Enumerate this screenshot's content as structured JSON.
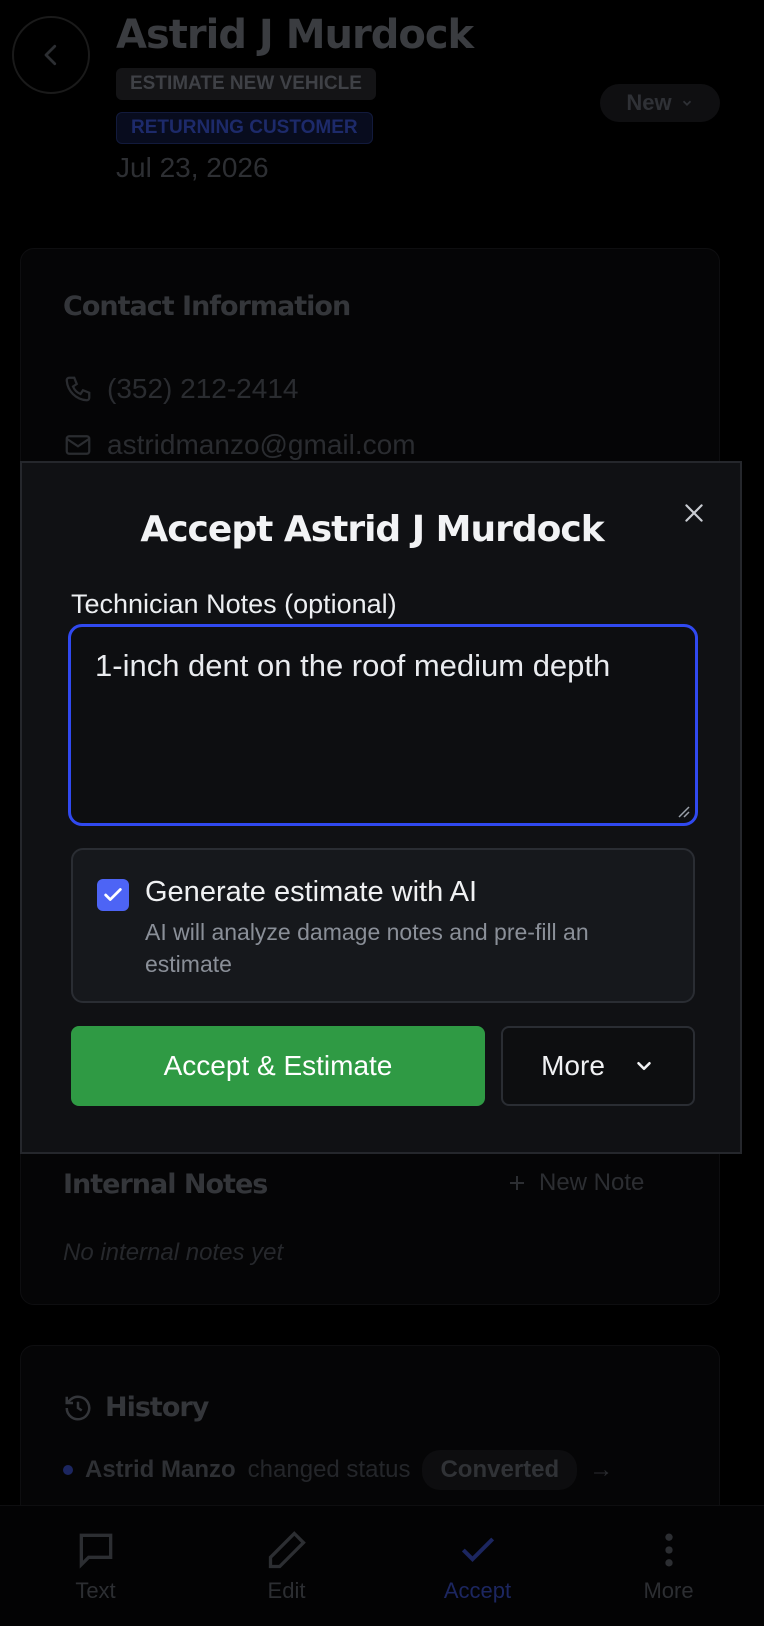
{
  "header": {
    "customer_name": "Astrid J Murdock",
    "type_tag": "ESTIMATE NEW VEHICLE",
    "customer_tag": "RETURNING CUSTOMER",
    "date": "Jul 23, 2026",
    "status": "New"
  },
  "contact": {
    "title": "Contact Information",
    "phone": "(352) 212-2414",
    "email": "astridmanzo@gmail.com"
  },
  "internal_notes": {
    "title": "Internal Notes",
    "new_note_label": "New Note",
    "empty_text": "No internal notes yet"
  },
  "history": {
    "title": "History",
    "entry_user": "Astrid Manzo",
    "entry_action": "changed status",
    "entry_status": "Converted",
    "entry_arrow": "→"
  },
  "bottom_nav": {
    "items": [
      {
        "label": "Text",
        "icon": "message-icon"
      },
      {
        "label": "Edit",
        "icon": "pencil-icon"
      },
      {
        "label": "Accept",
        "icon": "check-icon"
      },
      {
        "label": "More",
        "icon": "dots-vertical-icon"
      }
    ]
  },
  "modal": {
    "title": "Accept Astrid J Murdock",
    "notes_label": "Technician Notes (optional)",
    "notes_value": "1-inch dent on the roof medium depth",
    "ai_checked": true,
    "ai_title": "Generate estimate with AI",
    "ai_description": "AI will analyze damage notes and pre-fill an estimate",
    "accept_label": "Accept & Estimate",
    "more_label": "More"
  },
  "colors": {
    "accent_blue": "#3049f0",
    "checkbox_blue": "#4d64f5",
    "accept_green": "#2f9a44",
    "modal_bg": "#101114"
  }
}
